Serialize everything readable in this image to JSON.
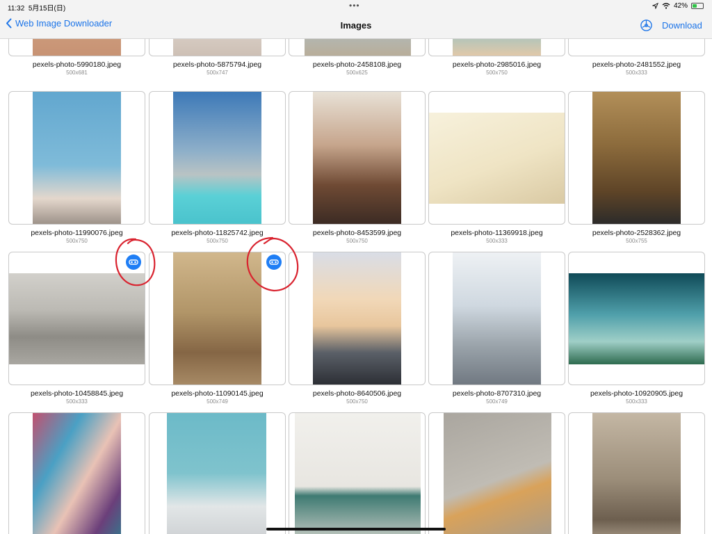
{
  "status": {
    "time": "11:32",
    "date": "5月15日(日)",
    "battery": "42%",
    "battery_level": 0.42
  },
  "nav": {
    "back_label": "Web Image Downloader",
    "title": "Images",
    "download_label": "Download"
  },
  "colors": {
    "accent": "#1a73e8",
    "badge": "#1f7ef5",
    "annotation": "#d9232f"
  },
  "images": [
    {
      "name": "pexels-photo-5990180.jpeg",
      "dims": "500x681"
    },
    {
      "name": "pexels-photo-5875794.jpeg",
      "dims": "500x747"
    },
    {
      "name": "pexels-photo-2458108.jpeg",
      "dims": "500x625"
    },
    {
      "name": "pexels-photo-2985016.jpeg",
      "dims": "500x750"
    },
    {
      "name": "pexels-photo-2481552.jpeg",
      "dims": "500x333"
    },
    {
      "name": "pexels-photo-11990076.jpeg",
      "dims": "500x750"
    },
    {
      "name": "pexels-photo-11825742.jpeg",
      "dims": "500x750"
    },
    {
      "name": "pexels-photo-8453599.jpeg",
      "dims": "500x750"
    },
    {
      "name": "pexels-photo-11369918.jpeg",
      "dims": "500x333"
    },
    {
      "name": "pexels-photo-2528362.jpeg",
      "dims": "500x755"
    },
    {
      "name": "pexels-photo-10458845.jpeg",
      "dims": "500x333",
      "selected": true
    },
    {
      "name": "pexels-photo-11090145.jpeg",
      "dims": "500x749",
      "selected": true
    },
    {
      "name": "pexels-photo-8640506.jpeg",
      "dims": "500x750"
    },
    {
      "name": "pexels-photo-8707310.jpeg",
      "dims": "500x749"
    },
    {
      "name": "pexels-photo-10920905.jpeg",
      "dims": "500x333"
    },
    {
      "name": "",
      "dims": ""
    },
    {
      "name": "",
      "dims": ""
    },
    {
      "name": "",
      "dims": ""
    },
    {
      "name": "",
      "dims": ""
    },
    {
      "name": "",
      "dims": ""
    }
  ]
}
